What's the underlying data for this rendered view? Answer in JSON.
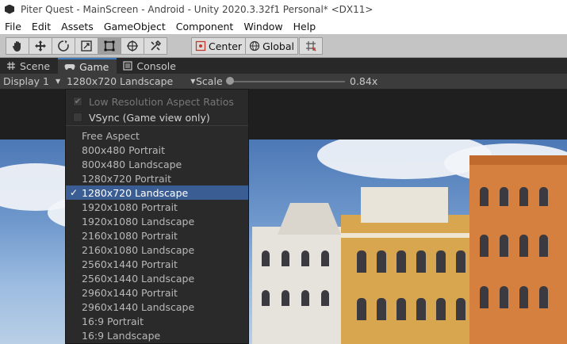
{
  "window": {
    "title": "Piter Quest - MainScreen - Android - Unity 2020.3.32f1 Personal* <DX11>"
  },
  "menu": [
    "File",
    "Edit",
    "Assets",
    "GameObject",
    "Component",
    "Window",
    "Help"
  ],
  "toolbar": {
    "tools": [
      "hand-tool",
      "move-tool",
      "rotate-tool",
      "scale-tool",
      "rect-tool",
      "transform-tool",
      "custom-tool"
    ],
    "active_tool": "rect-tool",
    "pivot_label": "Center",
    "space_label": "Global"
  },
  "tabs": [
    {
      "label": "Scene",
      "icon": "scene-icon"
    },
    {
      "label": "Game",
      "icon": "game-icon",
      "active": true
    },
    {
      "label": "Console",
      "icon": "console-icon"
    }
  ],
  "gamebar": {
    "display": "Display 1",
    "resolution": "1280x720 Landscape",
    "scale_label": "Scale",
    "scale_value": "0.84x",
    "scale_fraction": 0.0
  },
  "dropdown": {
    "options": [
      {
        "label": "Low Resolution Aspect Ratios",
        "checked": true,
        "enabled": false
      },
      {
        "label": "VSync (Game view only)",
        "checked": false,
        "enabled": true
      }
    ],
    "items": [
      "Free Aspect",
      "800x480 Portrait",
      "800x480 Landscape",
      "1280x720 Portrait",
      "1280x720 Landscape",
      "1920x1080 Portrait",
      "1920x1080 Landscape",
      "2160x1080 Portrait",
      "2160x1080 Landscape",
      "2560x1440 Portrait",
      "2560x1440 Landscape",
      "2960x1440 Portrait",
      "2960x1440 Landscape",
      "16:9 Portrait",
      "16:9 Landscape"
    ],
    "selected_index": 4,
    "check_glyph": "✓"
  },
  "colors": {
    "selection": "#3a5e93",
    "tab_accent": "#3a79bb"
  }
}
